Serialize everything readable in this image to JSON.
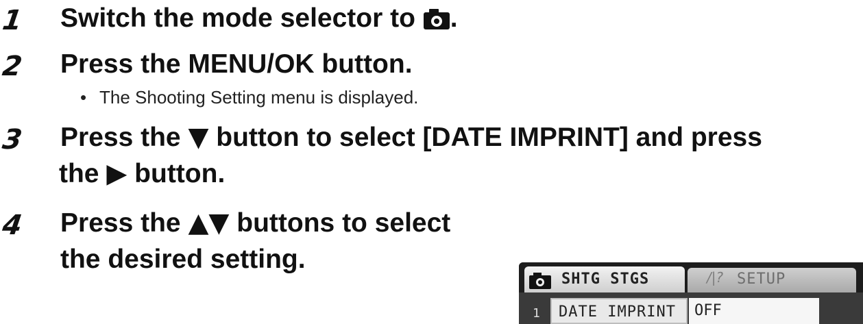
{
  "steps": [
    {
      "number": "1",
      "before": "Switch the mode selector to ",
      "icon": "camera-icon",
      "after": "."
    },
    {
      "number": "2",
      "text": "Press the MENU/OK button.",
      "bullet": "The Shooting Setting menu is displayed."
    },
    {
      "number": "3",
      "part1": "Press the ",
      "down_glyph": "▼",
      "part2": " button to select [DATE IMPRINT] and press",
      "part3": "the ",
      "right_glyph": "▶",
      "part4": " button."
    },
    {
      "number": "4",
      "part1": "Press the ",
      "updown_glyph": "▲▼",
      "part2": " buttons to select",
      "line2": "the desired setting."
    }
  ],
  "lcd": {
    "tab_active": "SHTG STGS",
    "tab_inactive": "SETUP",
    "row_index": "1",
    "row_item": "DATE IMPRINT",
    "row_value": "OFF"
  },
  "colors": {
    "text": "#111111",
    "lcd_bg": "#2b2b2b"
  }
}
